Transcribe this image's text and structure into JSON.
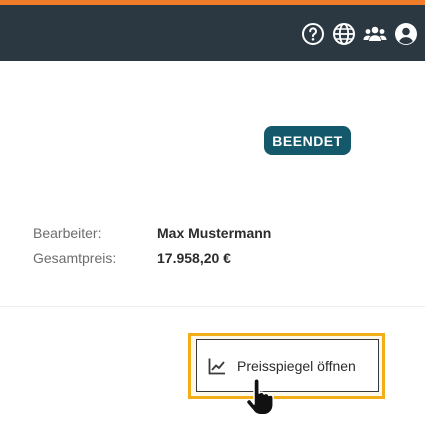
{
  "header": {
    "accent_color": "#f07c2a",
    "background_color": "#2b3741",
    "icons": [
      "help-icon",
      "globe-icon",
      "users-icon",
      "account-icon"
    ]
  },
  "status": {
    "badge_label": "BEENDET",
    "badge_color": "#13586b"
  },
  "details": [
    {
      "label": "Bearbeiter:",
      "value": "Max Mustermann"
    },
    {
      "label": "Gesamtpreis:",
      "value": "17.958,20 €"
    }
  ],
  "actions": {
    "price_mirror_label": "Preisspiegel öffnen",
    "price_mirror_icon": "line-chart-icon",
    "highlight_color": "#f2ae17"
  },
  "cursor": "hand-pointer-icon"
}
